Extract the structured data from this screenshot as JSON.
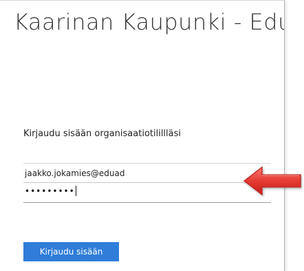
{
  "login": {
    "title": "Kaarinan Kaupunki - EduFS",
    "prompt": "Kirjaudu sisään organisaatiotilillläsi",
    "username_value": "jaakko.jokamies@eduad",
    "password_mask": "•••••••••",
    "signin_label": "Kirjaudu sisään"
  },
  "colors": {
    "button": "#2f7dd8",
    "arrow": "#e64545"
  },
  "icons": {
    "annotation": "arrow-left-icon"
  }
}
